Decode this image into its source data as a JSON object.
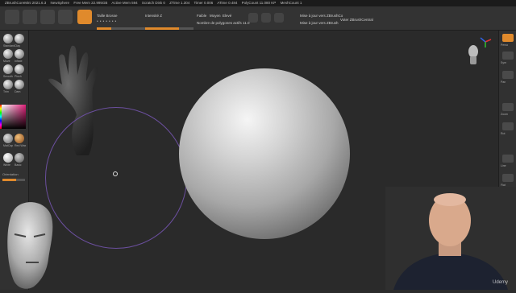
{
  "titlebar": {
    "items": [
      "ZBrushCoreMini 2021.6.3",
      "NewSphere",
      "Free Mem 22.995GB",
      "Active Mem 594",
      "Scratch Disk 0",
      "ZTime 1.304",
      "Timer 0.006",
      "ATime 0.484",
      "PolyCount 11.080 KP",
      "MeshCount 1"
    ]
  },
  "toolbar": {
    "brush_label": "Taille Brosse",
    "intensity_label": "Intensité Z",
    "faible_label": "Faible",
    "moyen_label": "Moyen",
    "eleve_label": "Elevé",
    "poly_label": "Nombre de polygones actifs 11.0",
    "update_line1": "Mise à jour vers ZBrushCo",
    "update_line2": "Mise à jour vers ZBrush",
    "update_line3": "Voter ZBrushCentral",
    "colors": {
      "accent": "#e08a2c",
      "panel": "#333333",
      "canvas": "#2a2a2a"
    },
    "brush_value": 0.3,
    "intensity_value": 0.7
  },
  "left_panel": {
    "label_orientation": "Orientation",
    "brush_labels": [
      "Standard",
      "Clay",
      "Move",
      "Inflate",
      "Smooth",
      "Pinch",
      "Trim",
      "Dam"
    ],
    "material_labels": [
      "MatCap",
      "Red Wax"
    ],
    "material_labels2": [
      "White",
      "Basic"
    ]
  },
  "right_panel": {
    "labels": [
      "Perso",
      "Sym",
      "Pan",
      "Zoom",
      "Rot",
      "Line",
      "Flat"
    ]
  },
  "watermark": "Udemy"
}
